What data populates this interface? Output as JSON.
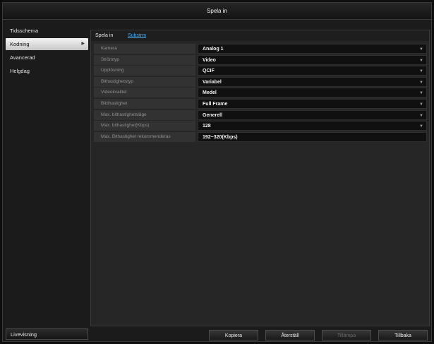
{
  "window": {
    "title": "Spela in"
  },
  "sidebar": {
    "items": [
      {
        "label": "Tidsschema",
        "active": false
      },
      {
        "label": "Kodning",
        "active": true
      },
      {
        "label": "Avancerad",
        "active": false
      },
      {
        "label": "Helgdag",
        "active": false
      }
    ],
    "liveview_label": "Livevisning"
  },
  "tabs": {
    "record": "Spela in",
    "substream": "Substrm"
  },
  "form": {
    "rows": [
      {
        "label": "Kamera",
        "value": "Analog 1"
      },
      {
        "label": "Strömtyp",
        "value": "Video"
      },
      {
        "label": "Upplösning",
        "value": "QCIF"
      },
      {
        "label": "Bithastighetstyp",
        "value": "Variabel"
      },
      {
        "label": "Videokvalitet",
        "value": "Medel"
      },
      {
        "label": "Bildhastighet",
        "value": "Full Frame"
      },
      {
        "label": "Max. bithastighetsläge",
        "value": "Generell"
      },
      {
        "label": "Max. bithastighet(Kbps)",
        "value": "128"
      },
      {
        "label": "Max. Bithastighet rekommenderas",
        "value": "192~320(Kbps)"
      }
    ]
  },
  "buttons": {
    "copy": "Kopiera",
    "default": "Återställ",
    "apply": "Tillämpa",
    "back": "Tillbaka"
  },
  "icons": {
    "dropdown": "chevron-down-icon",
    "submenu": "chevron-right-icon"
  },
  "colors": {
    "link": "#4fa8e8",
    "active_item": "#e0e0e0"
  }
}
